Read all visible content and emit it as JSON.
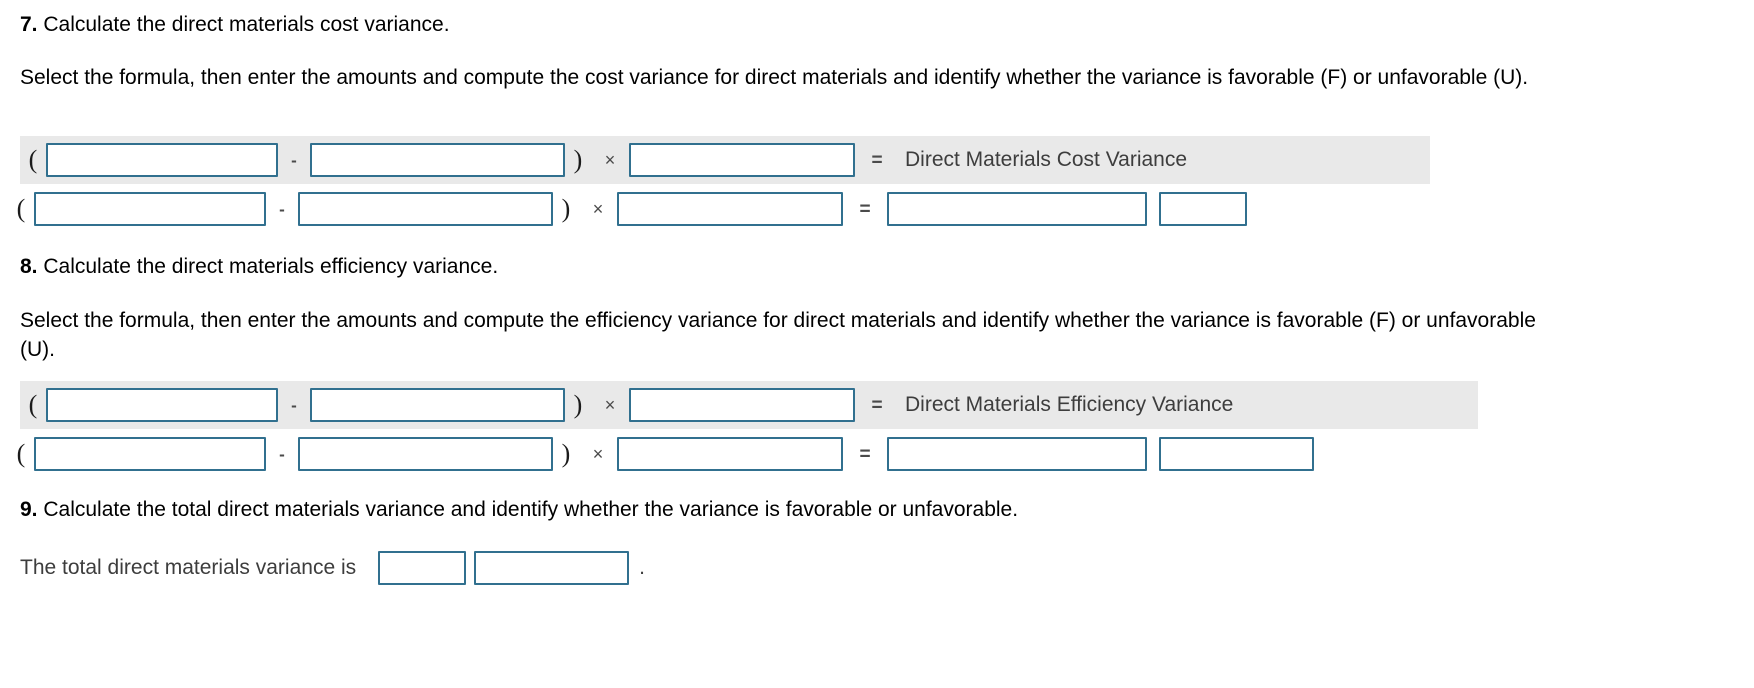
{
  "document": {
    "title": "Direct Materials Variance Worksheet"
  },
  "questions": [
    {
      "number": "7.",
      "heading": "Calculate the direct materials cost variance.",
      "instruction": "Select the formula, then enter the amounts and compute the cost variance for direct materials and identify whether the variance is favorable (F) or unfavorable (U).",
      "formula_row": {
        "paren_open": "(",
        "minus": "-",
        "paren_close": ")",
        "times": "×",
        "equals": "=",
        "result_label": "Direct Materials Cost Variance",
        "field_1_value": "",
        "field_2_value": "",
        "field_3_value": ""
      },
      "amount_row": {
        "paren_open": "(",
        "minus": "-",
        "paren_close": ")",
        "times": "×",
        "equals": "=",
        "field_1_value": "",
        "field_2_value": "",
        "field_3_value": "",
        "field_result_value": "",
        "field_fu_value": ""
      }
    },
    {
      "number": "8.",
      "heading": "Calculate the direct materials efficiency variance.",
      "instruction": "Select the formula, then enter the amounts and compute the efficiency variance for direct materials and identify whether the variance is favorable (F) or unfavorable (U).",
      "formula_row": {
        "paren_open": "(",
        "minus": "-",
        "paren_close": ")",
        "times": "×",
        "equals": "=",
        "result_label": "Direct Materials Efficiency Variance",
        "field_1_value": "",
        "field_2_value": "",
        "field_3_value": ""
      },
      "amount_row": {
        "paren_open": "(",
        "minus": "-",
        "paren_close": ")",
        "times": "×",
        "equals": "=",
        "field_1_value": "",
        "field_2_value": "",
        "field_3_value": "",
        "field_result_value": "",
        "field_fu_value": ""
      }
    },
    {
      "number": "9.",
      "heading": "Calculate the total direct materials variance and identify whether the variance is favorable or unfavorable.",
      "answer": {
        "lead_text": "The total direct materials variance is",
        "field_amount_value": "",
        "field_fu_value": "",
        "period": "."
      }
    }
  ],
  "colors": {
    "field_border": "#31708f",
    "row_shade": "#e9e9e9",
    "label_text": "#3d3d3d",
    "body_text": "#000000"
  }
}
